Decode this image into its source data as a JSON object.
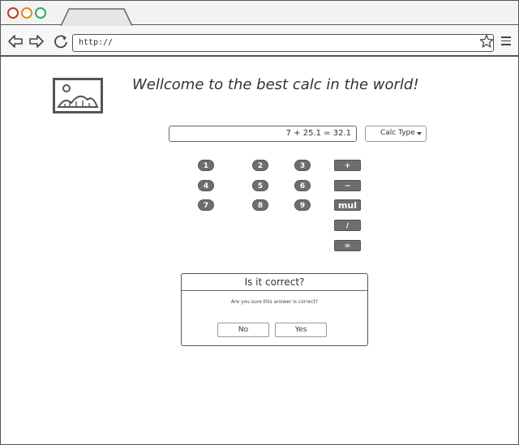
{
  "browser": {
    "address": "http://",
    "buttons": [
      "close",
      "minimize",
      "maximize"
    ]
  },
  "page": {
    "heading": "Wellcome to the best calc in the world!",
    "display_value": "7 + 25.1 = 32.1",
    "calc_type_label": "Calc Type"
  },
  "keypad": {
    "digits": [
      "1",
      "2",
      "3",
      "4",
      "5",
      "6",
      "7",
      "8",
      "9"
    ],
    "operators": [
      "+",
      "−",
      "mul",
      "/",
      "="
    ]
  },
  "dialog": {
    "title": "Is it correct?",
    "message": "Are you sure this answer is correct?",
    "no_label": "No",
    "yes_label": "Yes"
  },
  "colors": {
    "close": "#c0392b",
    "minimize": "#e08e0b",
    "maximize": "#27ae60",
    "key": "#6e6e6e"
  }
}
